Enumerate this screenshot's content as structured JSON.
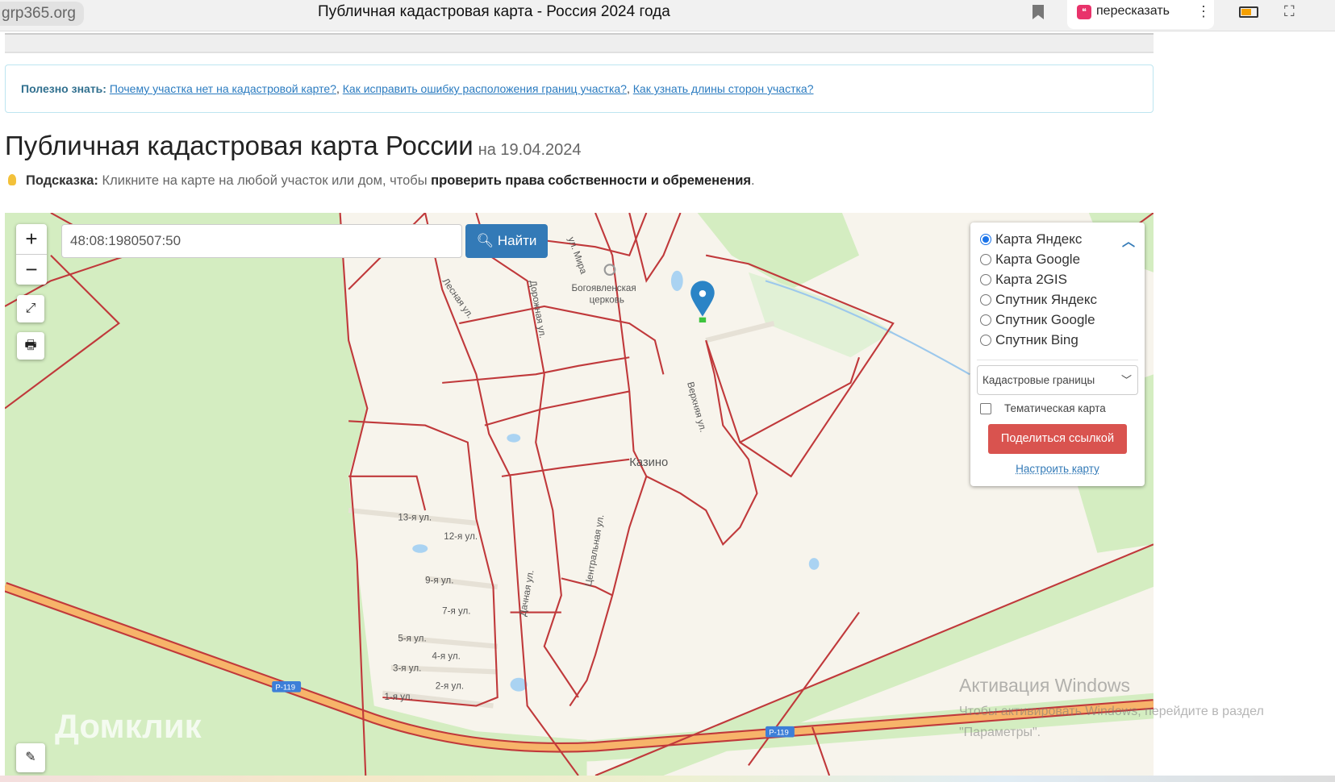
{
  "browser": {
    "domain": "grp365.org",
    "title": "Публичная кадастровая карта - Россия 2024 года",
    "retell_label": "пересказать"
  },
  "info": {
    "label": "Полезно знать:",
    "links": [
      "Почему участка нет на кадастровой карте?",
      "Как исправить ошибку расположения границ участка?",
      "Как узнать длины сторон участка?"
    ]
  },
  "page": {
    "title": "Публичная кадастровая карта России",
    "date": "на 19.04.2024"
  },
  "hint": {
    "label": "Подсказка:",
    "text": "Кликните на карте на любой участок или дом, чтобы",
    "bold": "проверить права собственности и обременения",
    "end": "."
  },
  "search": {
    "value": "48:08:1980507:50",
    "button": "Найти"
  },
  "zoom": {
    "plus": "+",
    "minus": "−"
  },
  "layers": {
    "options": [
      "Карта Яндекс",
      "Карта Google",
      "Карта 2GIS",
      "Спутник Яндекс",
      "Спутник Google",
      "Спутник Bing"
    ],
    "selected": 0,
    "overlay": "Кадастровые границы",
    "thematic": "Тематическая карта",
    "share": "Поделиться ссылкой",
    "setup": "Настроить карту"
  },
  "map_labels": {
    "village": "Казино",
    "church1": "Богоявленская",
    "church2": "церковь",
    "streets": [
      "13-я ул.",
      "12-я ул.",
      "9-я ул.",
      "7-я ул.",
      "5-я ул.",
      "4-я ул.",
      "3-я ул.",
      "2-я ул.",
      "1-я ул."
    ],
    "central": "Центральная ул.",
    "lesnaya": "Лесная ул.",
    "dorozhnaya": "Дорожная ул.",
    "verkhnyaya": "Верхняя ул.",
    "mira": "ул. Мира",
    "road1": "Р-119",
    "road2": "Р-119",
    "dachnaya": "Дачная ул."
  },
  "watermarks": {
    "domklik": "Домклик",
    "win_title": "Активация Windows",
    "win_text": "Чтобы активировать Windows, перейдите в раздел \"Параметры\"."
  },
  "colors": {
    "accent": "#337ab7",
    "share": "#d9534f",
    "cadastral": "#c0393b",
    "forest": "#d4edc1",
    "road": "#f7b46a"
  }
}
